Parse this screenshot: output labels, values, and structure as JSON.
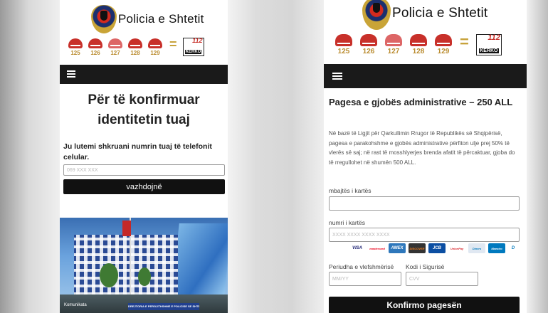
{
  "brand": {
    "title": "Policia e Shtetit"
  },
  "services": [
    "125",
    "126",
    "127",
    "128",
    "129"
  ],
  "equals": "=",
  "kerko": {
    "number": "112",
    "label": "KËRKO"
  },
  "left": {
    "heading_line1": "Për të konfirmuar",
    "heading_line2": "identitetin tuaj",
    "instruction": "Ju lutemi shkruani numrin tuaj të telefonit celular.",
    "phone_placeholder": "069 XXX XXX",
    "continue_button": "vazhdojnë",
    "photo": {
      "caption_left": "Komunikata",
      "sign_text": "DREJTORIA E PERGJITHSHME E POLICISE SE SHTETIT"
    }
  },
  "right": {
    "title": "Pagesa e gjobës administrative – 250 ALL",
    "description": "Në bazë të Ligjit për Qarkullimin Rrugor të Republikës së Shqipërisë, pagesa e parakohshme e gjobës administrative përfiton ulje prej 50% të vlerës së saj; në rast të mosshlyerjes brenda afatit të përcaktuar, gjoba do të rregullohet në shumën 500 ALL.",
    "cardholder_label": "mbajtës i kartës",
    "card_number_label": "numri i kartës",
    "card_number_placeholder": "XXXX XXXX XXXX XXXX",
    "expiry_label": "Periudha e vlefshmërisë",
    "expiry_placeholder": "MM/YY",
    "cvv_label": "Kodi i Sigurisë",
    "cvv_placeholder": "CVV",
    "submit_button": "Konfirmo pagesën",
    "card_brands": [
      "VISA",
      "mastercard",
      "AMEX",
      "DISCOVER",
      "JCB",
      "UnionPay",
      "Diners",
      "Maestro",
      "D"
    ]
  },
  "colors": {
    "navbar": "#1a1a1a",
    "service_red": "#c8302a",
    "service_gold": "#b98b2e",
    "button_dark": "#111111"
  }
}
